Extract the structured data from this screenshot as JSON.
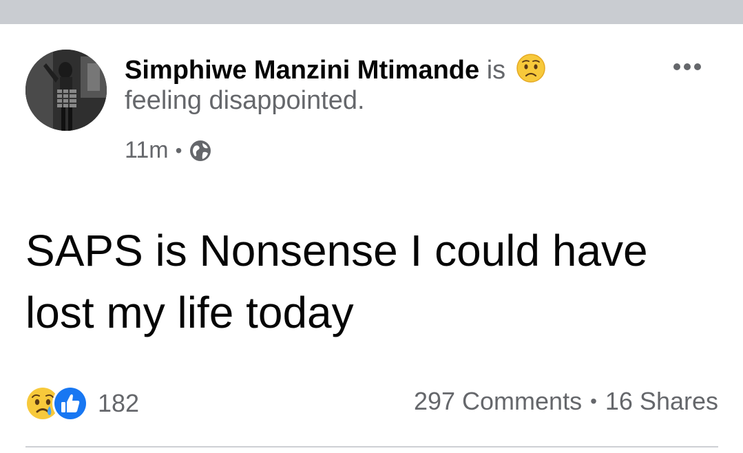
{
  "post": {
    "author": "Simphiwe Manzini Mtimande",
    "feeling_prefix": "is",
    "feeling_icon": "disappointed-face-emoji",
    "feeling_text": "feeling disappointed.",
    "timestamp": "11m",
    "separator": "•",
    "privacy_icon": "globe-icon",
    "body": "SAPS is Nonsense I could have lost my life today"
  },
  "stats": {
    "reaction_icons": [
      "sad-reaction-icon",
      "like-reaction-icon"
    ],
    "reaction_count": "182",
    "comments": "297 Comments",
    "separator": "•",
    "shares": "16 Shares"
  },
  "colors": {
    "top_bar": "#c9ccd1",
    "primary_text": "#050505",
    "secondary_text": "#65676b",
    "like_blue": "#1877f2",
    "emoji_yellow": "#f7c93b"
  }
}
